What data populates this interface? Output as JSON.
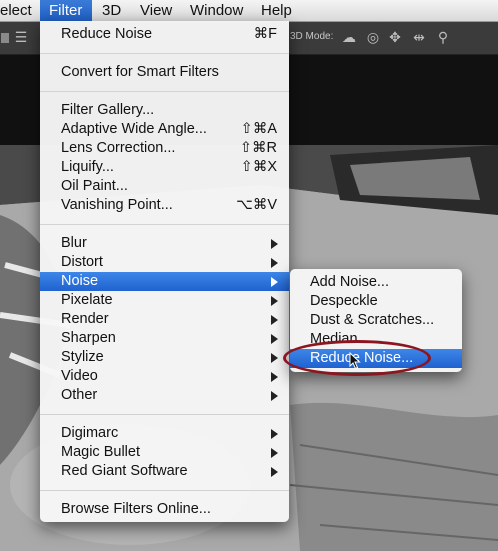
{
  "menubar": {
    "items": [
      {
        "label": "elect"
      },
      {
        "label": "Filter",
        "active": true
      },
      {
        "label": "3D"
      },
      {
        "label": "View"
      },
      {
        "label": "Window"
      },
      {
        "label": "Help"
      }
    ]
  },
  "toolbar": {
    "mode_label": "3D Mode:"
  },
  "filter_menu": {
    "last_filter": {
      "label": "Reduce Noise",
      "shortcut": "⌘F"
    },
    "convert": {
      "label": "Convert for Smart Filters"
    },
    "filters": [
      {
        "label": "Filter Gallery...",
        "shortcut": ""
      },
      {
        "label": "Adaptive Wide Angle...",
        "shortcut": "⇧⌘A"
      },
      {
        "label": "Lens Correction...",
        "shortcut": "⇧⌘R"
      },
      {
        "label": "Liquify...",
        "shortcut": "⇧⌘X"
      },
      {
        "label": "Oil Paint...",
        "shortcut": ""
      },
      {
        "label": "Vanishing Point...",
        "shortcut": "⌥⌘V"
      }
    ],
    "categories": [
      {
        "label": "Blur"
      },
      {
        "label": "Distort"
      },
      {
        "label": "Noise",
        "highlighted": true
      },
      {
        "label": "Pixelate"
      },
      {
        "label": "Render"
      },
      {
        "label": "Sharpen"
      },
      {
        "label": "Stylize"
      },
      {
        "label": "Video"
      },
      {
        "label": "Other"
      }
    ],
    "plugins": [
      {
        "label": "Digimarc"
      },
      {
        "label": "Magic Bullet"
      },
      {
        "label": "Red Giant Software"
      }
    ],
    "browse": {
      "label": "Browse Filters Online..."
    }
  },
  "noise_submenu": {
    "items": [
      {
        "label": "Add Noise..."
      },
      {
        "label": "Despeckle"
      },
      {
        "label": "Dust & Scratches..."
      },
      {
        "label": "Median..."
      },
      {
        "label": "Reduce Noise...",
        "highlighted": true
      }
    ]
  },
  "colors": {
    "highlight": "#2a6fd8",
    "annotation_oval": "#8c1620"
  }
}
